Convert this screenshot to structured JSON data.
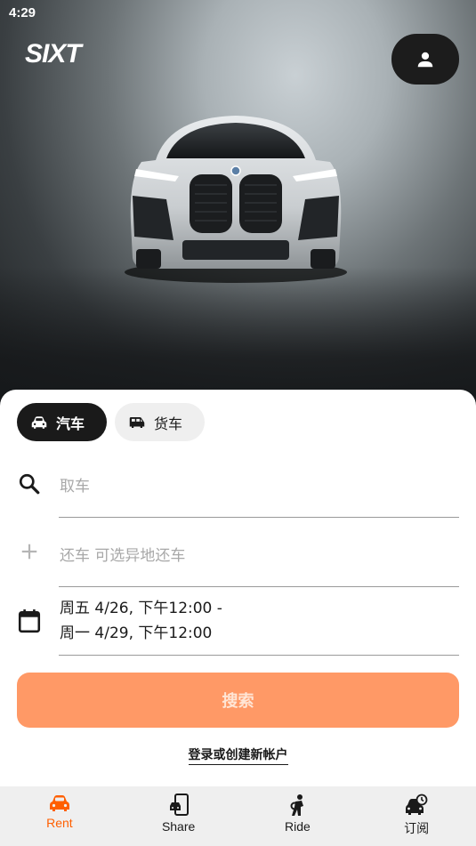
{
  "status_bar": {
    "time": "4:29"
  },
  "header": {
    "logo_text": "SIXT",
    "profile_icon": "person-icon"
  },
  "vehicle_toggle": {
    "car_label": "汽车",
    "truck_label": "货车",
    "selected": "car"
  },
  "form": {
    "pickup_placeholder": "取车",
    "return_placeholder": "还车 可选异地还车",
    "date_line1": "周五 4/26, 下午12:00 -",
    "date_line2": "周一 4/29, 下午12:00",
    "search_label": "搜索",
    "login_label": "登录或创建新帐户"
  },
  "tabbar": {
    "items": [
      {
        "label": "Rent",
        "icon": "car-icon",
        "active": true
      },
      {
        "label": "Share",
        "icon": "phone-car-icon",
        "active": false
      },
      {
        "label": "Ride",
        "icon": "chauffeur-icon",
        "active": false
      },
      {
        "label": "订阅",
        "icon": "car-clock-icon",
        "active": false
      }
    ]
  },
  "colors": {
    "accent": "#ff5f00",
    "search_button": "#ff9966",
    "dark": "#1a1a1a"
  }
}
